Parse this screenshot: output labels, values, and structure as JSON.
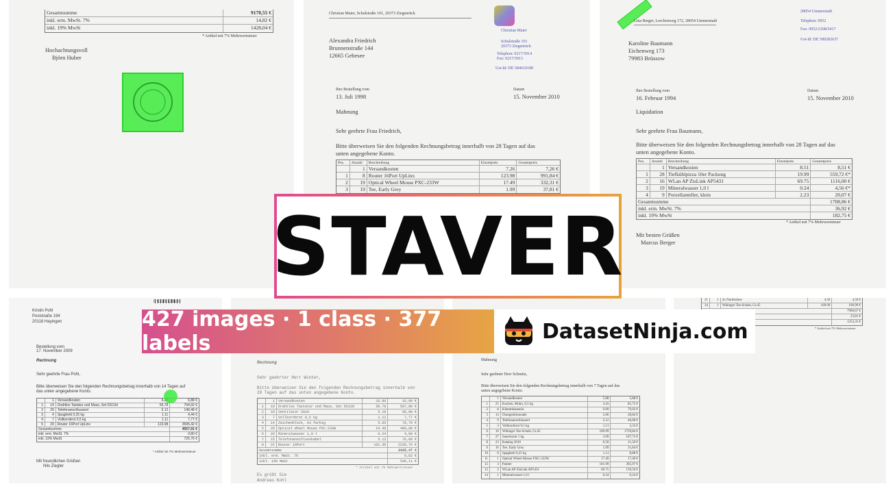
{
  "banner": {
    "title": "STAVER",
    "stats": "427 images · 1 class · 377 labels",
    "brand": "DatasetNinja.com",
    "accent_start": "#d5508f",
    "accent_end": "#e7a544",
    "label_color": "#3ceb3c"
  },
  "tile1": {
    "row1_label": "Gesamtsumme",
    "row1_value": "9170,55 €",
    "row2_label": "inkl. erm. MwSt. 7%",
    "row2_value": "14,82 €",
    "row3_label": "inkl. 19% MwSt",
    "row3_value": "1428,04 €",
    "note": "* Artikel mit 7% Mehrwertsteuer",
    "closing": "Hochachtungsvoll",
    "signer": "Björn Huber"
  },
  "tile2": {
    "sender": "Christian Maier, Schulstraße 101, 20373 Ziegenrück",
    "recipient_name": "Alexandra Friedrich",
    "recipient_street": "Brunnenstraße 144",
    "recipient_city": "12665 Gebesee",
    "side_name": "Christian Maier",
    "side_street": "Schulstraße 101",
    "side_city": "20373 Ziegenrück",
    "side_phone": "Telephon: 0217/5914",
    "side_fax": "Fax: 0217/5913",
    "side_vat": "Ust-Id: DE 584610188",
    "order_label": "Ihre Bestellung vom",
    "order_date": "13. Juli 1998",
    "date_label": "Datum",
    "date": "15. November 2010",
    "subject": "Mahnung",
    "salutation": "Sehr geehrte Frau Friedrich,",
    "body_1": "Bitte überweisen Sie den folgenden Rechnungsbetrag innerhalb von 28 Tagen auf das",
    "body_2": "unten angegebene Konto.",
    "headers": [
      "Pos.",
      "Anzahl",
      "Beschreibung",
      "Einzelpreis",
      "Gesamtpreis"
    ],
    "rows": [
      [
        "",
        "1",
        "Versandkosten",
        "7.26",
        "7,26 €"
      ],
      [
        "1",
        "8",
        "Router 16Port UpLinx",
        "123.98",
        "991,84 €"
      ],
      [
        "2",
        "19",
        "Optical Wheel Mouse PXC-233W",
        "17.49",
        "332,31 €"
      ],
      [
        "3",
        "19",
        "Tee, Early Grey",
        "1.99",
        "37,81 €"
      ]
    ]
  },
  "tile3": {
    "sender": "Lina Berger, Lorchenweg 172, 28054 Ummerstadt",
    "side_city": "28054 Ummerstadt",
    "side_phone": "Telephon: 0952",
    "side_fax": "Fax: 0952/2108/5417",
    "side_vat": "Ust-Id: DE 589282637",
    "recipient_name": "Karoline Baumann",
    "recipient_street": "Eichenweg 173",
    "recipient_city": "79983 Brüssow",
    "order_label": "Ihre Bestellung vom",
    "order_date": "16. Februar 1994",
    "date_label": "Datum",
    "date": "15. November 2010",
    "subject": "Liquidation",
    "salutation": "Sehr geehrte Frau Baumann,",
    "body_1": "Bitte überweisen Sie den folgenden Rechnungsbetrag innerhalb von 28 Tagen auf das",
    "body_2": "unten angegebene Konto.",
    "headers": [
      "Pos.",
      "Anzahl",
      "Beschreibung",
      "Einzelpreis",
      "Gesamtpreis"
    ],
    "rows": [
      [
        "",
        "1",
        "Versandkosten",
        "8.51",
        "8,51 €"
      ],
      [
        "1",
        "28",
        "Tiefkühlpizza 10er Packung",
        "19.99",
        "559,72 €*"
      ],
      [
        "2",
        "16",
        "WLan AP ZisLink AP5431",
        "69.75",
        "1116,00 €"
      ],
      [
        "3",
        "19",
        "Mineralwasser 1,0 l",
        "0.24",
        "4,56 €*"
      ],
      [
        "4",
        "9",
        "Porzellanteller, klein",
        "2.23",
        "20,07 €"
      ]
    ],
    "total_label": "Gesamtsumme",
    "total_value": "1708,86 €",
    "tax1_label": "inkl. erm. MwSt. 7%",
    "tax1_value": "36,92 €",
    "tax2_label": "inkl. 19% MwSt",
    "tax2_value": "182,75 €",
    "note": "* Artikel mit 7% Mehrwertsteuer",
    "closing": "Mit besten Grüßen",
    "signer": "Marcus Berger"
  },
  "tile4": {
    "barcode": "0 5310 12910",
    "recipient_name": "Kristin Pohl",
    "recipient_street": "Poststraße 194",
    "recipient_city": "20118 Hayingen",
    "order_label": "Bestellung vom",
    "order_date": "17. November 2009",
    "subject": "Rechnung",
    "salutation": "Sehr geehrte Frau Pohl,",
    "body_1": "Bitte überweisen Sie den folgenden Rechnungsbetrag innerhalb von 14 Tagen auf",
    "body_2": "das unten angegebene Konto.",
    "rows": [
      [
        "",
        "1",
        "Versandkosten",
        "6.88",
        "6,88 €"
      ],
      [
        "1",
        "14",
        "Drahtlos Tastatur und Maus, Set DS13d",
        "56.78",
        "794,92 €"
      ],
      [
        "2",
        "29",
        "Telefonanschlusseel",
        "5.12",
        "148,48 €"
      ],
      [
        "3",
        "4",
        "Spaghetti 0,25 kg",
        "1.11",
        "4,44 €"
      ],
      [
        "4",
        "7",
        "Vollkornbrot 0,5 kg",
        "1.11",
        "7,77 €"
      ],
      [
        "5",
        "29",
        "Router 16Port UpLinx",
        "123.98",
        "3595,42 €"
      ]
    ],
    "total_label": "Gesamtsumme",
    "total_value": "4557,91 €",
    "tax1_label": "inkl. erm. MwSt. 7%",
    "tax1_value": "0,80 €",
    "tax2_label": "inkl. 19% MwSt",
    "tax2_value": "725,76 €",
    "note": "* Artikel mit 7% Mehrwertsteuer",
    "closing": "Mit freundlichen Grüßen",
    "signer": "Nils Ziegler"
  },
  "tile5": {
    "subject": "Rechnung",
    "salutation": "Sehr geehrter Herr Winter,",
    "body_1": "Bitte überweisen Sie den folgenden Rechnungsbetrag innerhalb von",
    "body_2": "28 Tagen auf das unten angegebene Konto.",
    "rows": [
      [
        "",
        "1",
        "Versandkosten",
        "16.90",
        "16,90 €"
      ],
      [
        "1",
        "10",
        "Drahtlos Tastatur und Maus, Set DS13d",
        "58.78",
        "587,80 €"
      ],
      [
        "2",
        "19",
        "Ventilator 2010",
        "5.10",
        "96,90 €"
      ],
      [
        "3",
        "7",
        "Vollkornbrot 0,5 kg",
        "1.11",
        "7,77 €"
      ],
      [
        "4",
        "14",
        "Zeichenblock, A3 farbig",
        "5.05",
        "70,70 €"
      ],
      [
        "5",
        "20",
        "Optical Wheel Mouse PXC-233W",
        "24.49",
        "489,80 €"
      ],
      [
        "6",
        "20",
        "Mineralwasser 1,0 l",
        "0.24",
        "4,80 €"
      ],
      [
        "7",
        "15",
        "Telefonanschlusskabel",
        "5.12",
        "76,80 €"
      ],
      [
        "8",
        "22",
        "Router 16Port",
        "101.30",
        "2228,76 €"
      ]
    ],
    "total_label": "Gesamtsumme",
    "total_value": "3425,47 €",
    "tax1_label": "inkl. erm. MwSt. 7%",
    "tax1_value": "0,82 €",
    "tax2_label": "inkl. 19% MwSt",
    "tax2_value": "546,11 €",
    "note": "* Artikel mit 7% Mehrwertsteuer",
    "closing": "Es grüßt Sie",
    "signer": "Andreas Kohl"
  },
  "tile6": {
    "subject": "Mahnung",
    "salutation": "Sehr geehrter Herr Schmitz,",
    "body_1": "Bitte überweisen Sie den folgenden Rechnungsbetrag innerhalb von 7 Tagen auf das",
    "body_2": "unten angegebene Konto.",
    "rows": [
      [
        "",
        "1",
        "Versandkosten",
        "5.88",
        "5,88 €"
      ],
      [
        "1",
        "25",
        "Kuchen, Mohn, 0,5 kg",
        "3.43",
        "85,75 €"
      ],
      [
        "2",
        "8",
        "Klemmbaustein",
        "9.99",
        "79,92 €"
      ],
      [
        "3",
        "14",
        "Orangenlimonade",
        "2.06",
        "28,84 €"
      ],
      [
        "4",
        "9",
        "Telefonanschlusseel",
        "5.12",
        "46,08 €"
      ],
      [
        "5",
        "3",
        "Vollkornbrot 0,5 kg",
        "1.11",
        "3,33 €"
      ],
      [
        "6",
        "16",
        "Wikinger Tee-Schale, Gr.45",
        "109.99",
        "1759,84 €"
      ],
      [
        "7",
        "27",
        "Sauerkraut 1 kg",
        "3.99",
        "107,73 €"
      ],
      [
        "8",
        "23",
        "Katalog 2010",
        "0.50",
        "11,50 €"
      ],
      [
        "9",
        "16",
        "Tee, Early Grey",
        "1.99",
        "31,84 €"
      ],
      [
        "10",
        "8",
        "Spaghetti 0,25 kg",
        "1.11",
        "8,88 €"
      ],
      [
        "11",
        "1",
        "Optical Wheel Mouse PXC-233W",
        "17.49",
        "17,49 €"
      ],
      [
        "12",
        "3",
        "Paukte",
        "101.99",
        "305,97 €"
      ],
      [
        "13",
        "2",
        "WLan AP ZisLink AP5431",
        "69.75",
        "139,50 €"
      ],
      [
        "14",
        "1",
        "Mineralwasser 1,0 l",
        "0.24",
        "0,24 €"
      ]
    ]
  },
  "tile7": {
    "rows": [
      [
        "21",
        "1",
        "4x Nordisches",
        "4.50",
        "4,50 €"
      ],
      [
        "34",
        "1",
        "Wikinger Tee-Schale, Gr.45",
        "109.99",
        "109,99 €"
      ]
    ],
    "total_value": "7960,67 €",
    "tax1_value": "23,81 €",
    "tax2_value": "1253,35 €",
    "note": "* Artikel mit 7% Mehrwertsteuer"
  }
}
